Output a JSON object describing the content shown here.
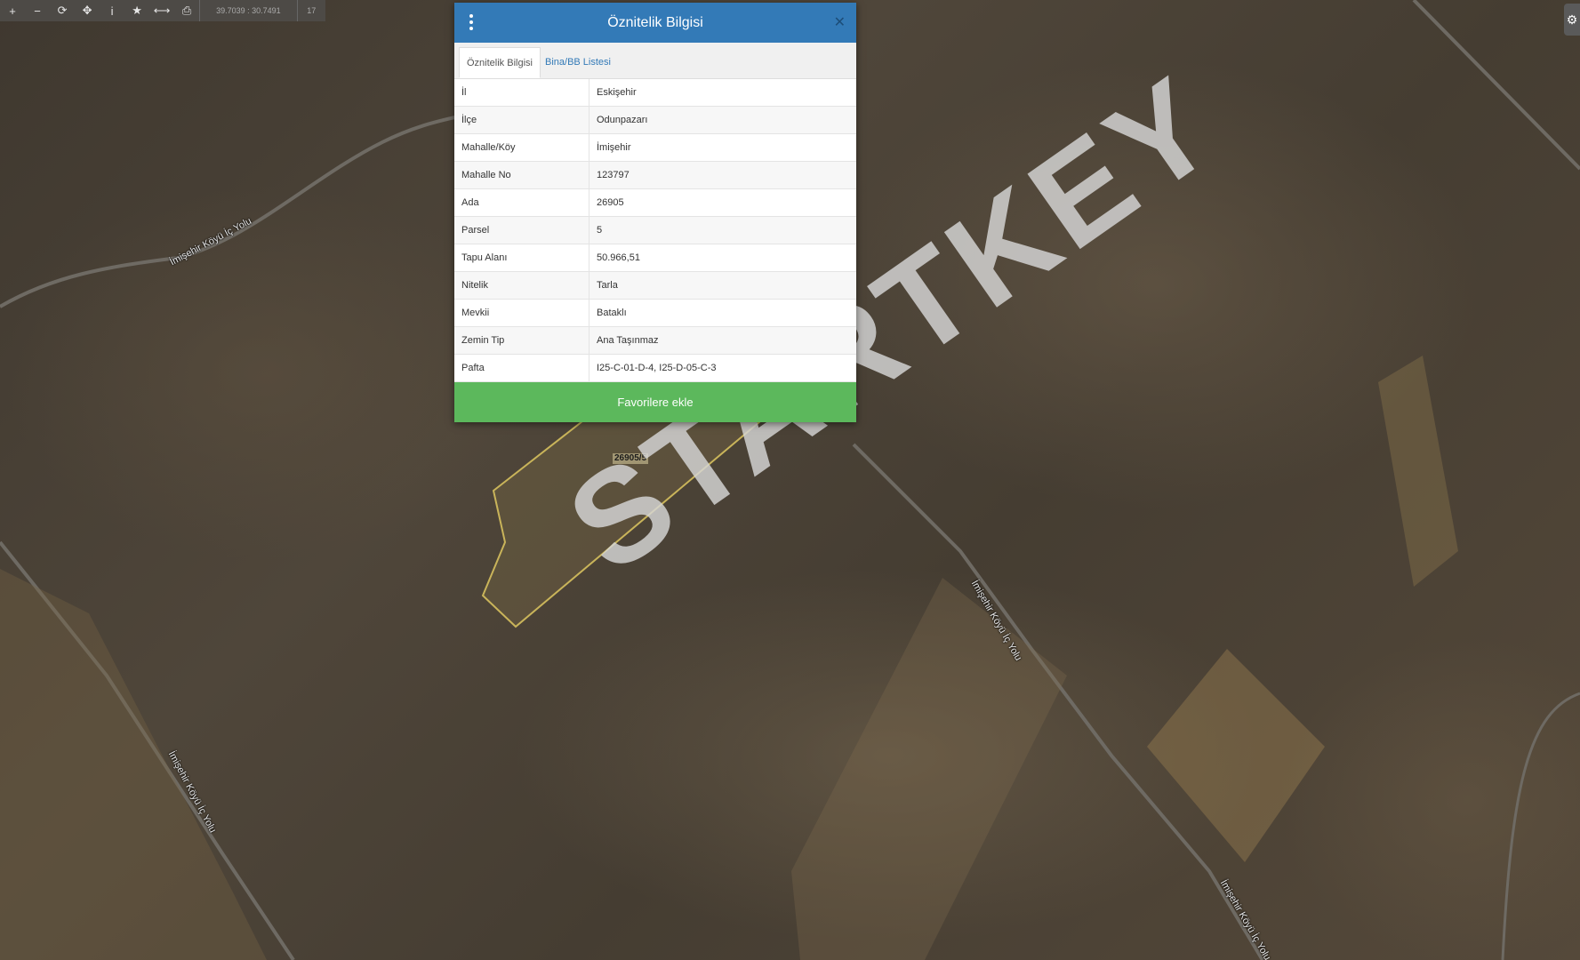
{
  "toolbar": {
    "buttons": [
      {
        "name": "zoom-in",
        "glyph": "+"
      },
      {
        "name": "zoom-out",
        "glyph": "−"
      },
      {
        "name": "refresh",
        "glyph": "⟳"
      },
      {
        "name": "locate",
        "glyph": "✥"
      },
      {
        "name": "info",
        "glyph": "i"
      },
      {
        "name": "favorite",
        "glyph": "★"
      },
      {
        "name": "measure",
        "glyph": "⟷"
      },
      {
        "name": "print",
        "glyph": "⎙"
      }
    ],
    "coordinates": "39.7039 : 30.7491",
    "zoom": "17"
  },
  "dialog": {
    "title": "Öznitelik Bilgisi",
    "tabs": [
      "Öznitelik Bilgisi",
      "Bina/BB Listesi"
    ],
    "rows": [
      {
        "key": "İl",
        "value": "Eskişehir"
      },
      {
        "key": "İlçe",
        "value": "Odunpazarı"
      },
      {
        "key": "Mahalle/Köy",
        "value": "İmişehir"
      },
      {
        "key": "Mahalle No",
        "value": "123797"
      },
      {
        "key": "Ada",
        "value": "26905"
      },
      {
        "key": "Parsel",
        "value": "5"
      },
      {
        "key": "Tapu Alanı",
        "value": "50.966,51"
      },
      {
        "key": "Nitelik",
        "value": "Tarla"
      },
      {
        "key": "Mevkii",
        "value": "Bataklı"
      },
      {
        "key": "Zemin Tip",
        "value": "Ana Taşınmaz"
      },
      {
        "key": "Pafta",
        "value": "I25-C-01-D-4, I25-D-05-C-3"
      }
    ],
    "favorite_label": "Favorilere ekle"
  },
  "map": {
    "parcel_label": "26905/5",
    "road_labels": [
      "İmişehir Köyü İç Yolu",
      "İmişehir Köyü İç Yolu",
      "İmişehir Köyü İç Yolu",
      "İmişehir Köyü İç Yolu"
    ],
    "watermark": "STARTKEY",
    "parcel_outline_color": "#c9b45a"
  }
}
